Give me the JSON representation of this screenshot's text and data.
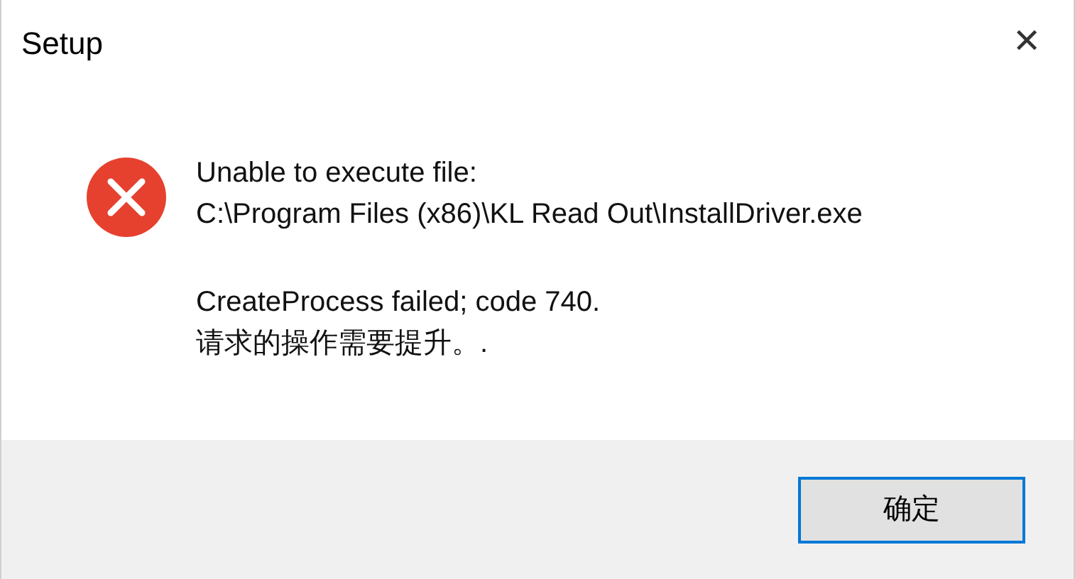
{
  "window": {
    "title": "Setup",
    "close": "✕"
  },
  "message": {
    "paragraphs": [
      [
        "Unable to execute file:",
        "C:\\Program Files (x86)\\KL Read Out\\InstallDriver.exe"
      ],
      [
        "CreateProcess failed; code 740.",
        "请求的操作需要提升。."
      ]
    ]
  },
  "buttons": [
    {
      "label": "确定",
      "selected": true
    }
  ]
}
